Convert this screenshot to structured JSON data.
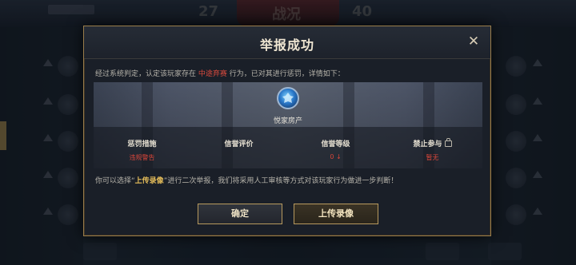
{
  "dialog": {
    "title": "举报成功",
    "close_label": "✕",
    "intro": {
      "prefix": "经过系统判定，认定该玩家存在",
      "highlight": "中途弃赛",
      "suffix": "行为，已对其进行惩罚，详情如下："
    },
    "player": {
      "name": "悦家房产"
    },
    "stats": [
      {
        "label": "惩罚措施",
        "value": "违规警告"
      },
      {
        "label": "信誉评价",
        "value": ""
      },
      {
        "label": "信誉等级",
        "value": "0 ↓"
      },
      {
        "label": "禁止参与",
        "value": "暂无",
        "has_lock": true
      }
    ],
    "note": {
      "prefix": "你可以选择“",
      "link": "上传录像",
      "suffix": "”进行二次举报，我们将采用人工审核等方式对该玩家行为做进一步判断！"
    },
    "buttons": {
      "confirm": "确定",
      "upload": "上传录像"
    }
  },
  "background": {
    "score_left": "27",
    "score_center": "战况",
    "score_right": "40"
  },
  "colors": {
    "accent_gold": "#b89a5e",
    "warning_red": "#d8463a",
    "highlight_gold": "#e5bd5a"
  }
}
